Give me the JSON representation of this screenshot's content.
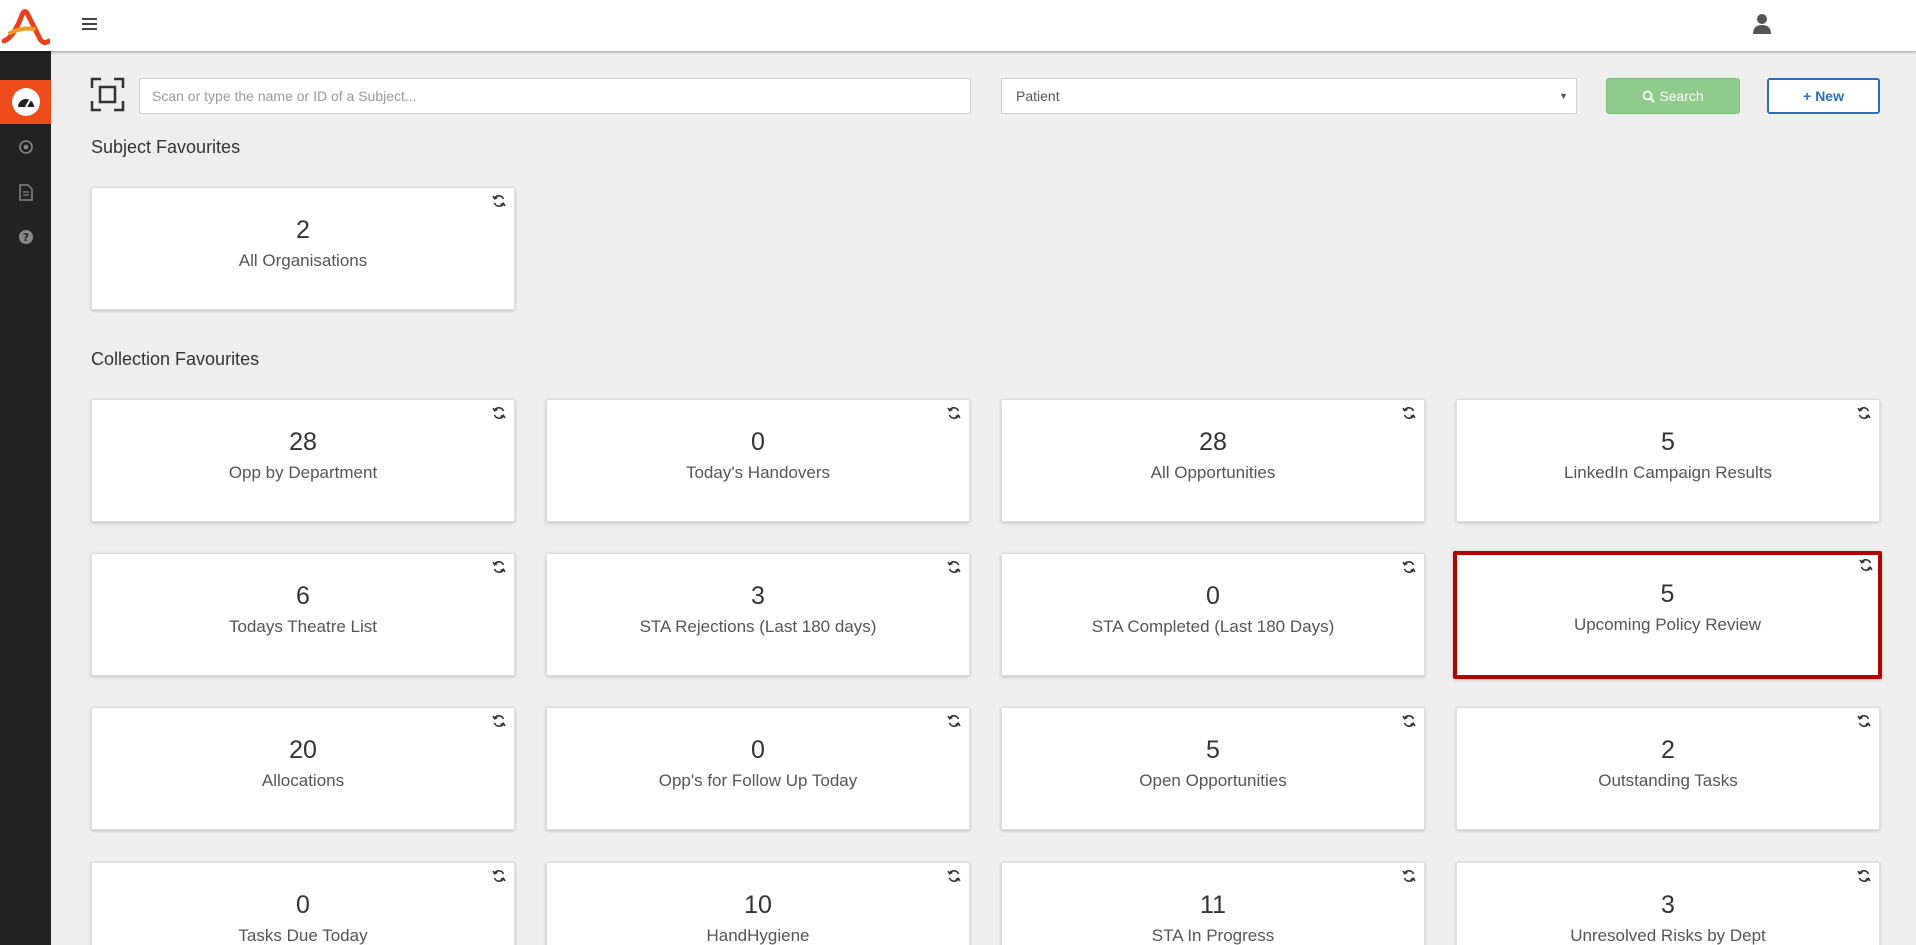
{
  "search": {
    "placeholder": "Scan or type the name or ID of a Subject...",
    "type_selected": "Patient",
    "search_label": "Search",
    "new_label": "New"
  },
  "subject_favourites": {
    "title": "Subject Favourites",
    "cards": [
      {
        "count": "2",
        "label": "All Organisations"
      }
    ]
  },
  "collection_favourites": {
    "title": "Collection Favourites",
    "cards": [
      {
        "count": "28",
        "label": "Opp by Department"
      },
      {
        "count": "0",
        "label": "Today's Handovers"
      },
      {
        "count": "28",
        "label": "All Opportunities"
      },
      {
        "count": "5",
        "label": "LinkedIn Campaign Results"
      },
      {
        "count": "6",
        "label": "Todays Theatre List"
      },
      {
        "count": "3",
        "label": "STA Rejections (Last 180 days)"
      },
      {
        "count": "0",
        "label": "STA Completed (Last 180 Days)"
      },
      {
        "count": "5",
        "label": "Upcoming Policy Review",
        "highlighted": true
      },
      {
        "count": "20",
        "label": "Allocations"
      },
      {
        "count": "0",
        "label": "Opp's for Follow Up Today"
      },
      {
        "count": "5",
        "label": "Open Opportunities"
      },
      {
        "count": "2",
        "label": "Outstanding Tasks"
      },
      {
        "count": "0",
        "label": "Tasks Due Today"
      },
      {
        "count": "10",
        "label": "HandHygiene"
      },
      {
        "count": "11",
        "label": "STA In Progress"
      },
      {
        "count": "3",
        "label": "Unresolved Risks by Dept"
      }
    ]
  },
  "sidebar": {
    "items": [
      {
        "icon": "dashboard-icon",
        "active": true
      },
      {
        "icon": "target-icon"
      },
      {
        "icon": "document-icon"
      },
      {
        "icon": "help-icon"
      }
    ]
  },
  "colors": {
    "accent": "#ee4b1d",
    "sidebar_bg": "#222222",
    "search_button": "#8fcb8b",
    "new_button": "#2a6ebb",
    "highlight_border": "#b30000"
  }
}
